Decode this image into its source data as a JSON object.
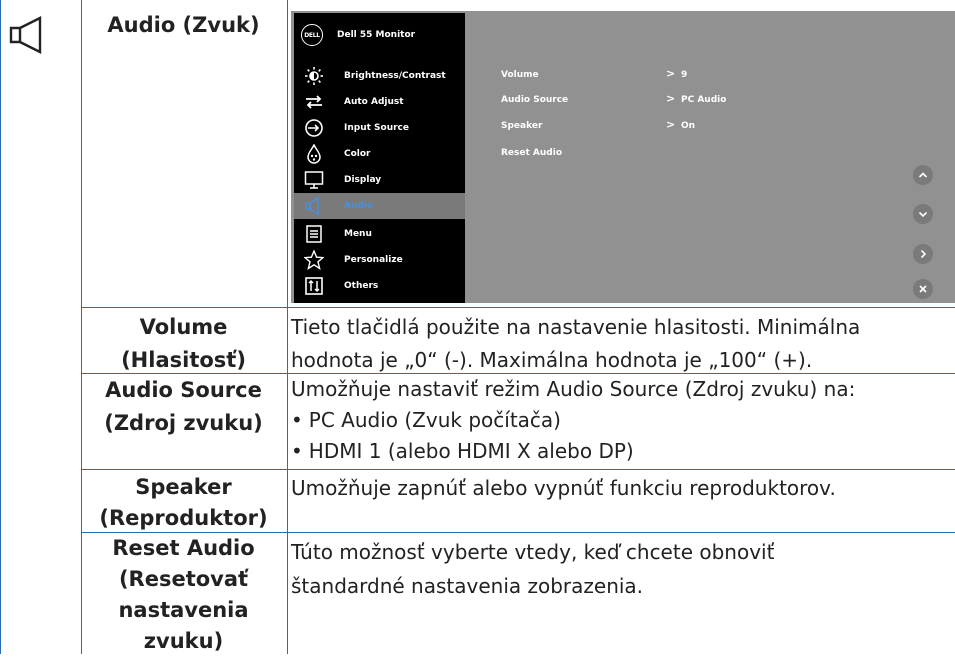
{
  "section_title": "Audio (Zvuk)",
  "osd": {
    "title": "Dell 55 Monitor",
    "logo_text": "DELL",
    "menu": [
      {
        "label": "Brightness/Contrast",
        "icon": "brightness-icon"
      },
      {
        "label": "Auto Adjust",
        "icon": "auto-adjust-icon"
      },
      {
        "label": "Input Source",
        "icon": "input-source-icon"
      },
      {
        "label": "Color",
        "icon": "color-icon"
      },
      {
        "label": "Display",
        "icon": "display-icon"
      },
      {
        "label": "Audio",
        "icon": "speaker-icon",
        "active": true
      },
      {
        "label": "Menu",
        "icon": "menu-icon"
      },
      {
        "label": "Personalize",
        "icon": "star-icon"
      },
      {
        "label": "Others",
        "icon": "others-icon"
      }
    ],
    "submenu": [
      {
        "label": "Volume",
        "value": "9"
      },
      {
        "label": "Audio Source",
        "value": "PC Audio"
      },
      {
        "label": "Speaker",
        "value": "On"
      },
      {
        "label": "Reset Audio",
        "value": ""
      }
    ],
    "nav_buttons": [
      "up-icon",
      "down-icon",
      "right-icon",
      "close-icon"
    ],
    "colors": {
      "panel_bg": "#919191",
      "menu_bg": "#000000",
      "active_bg": "#7a7a7a",
      "active_text": "#4a90d9"
    }
  },
  "rows": [
    {
      "head": [
        "Volume",
        "(Hlasitosť)"
      ],
      "desc": [
        "Tieto tlačidlá použite na nastavenie hlasitosti. Minimálna",
        "hodnota je „0“ (-). Maximálna hodnota je „100“ (+)."
      ]
    },
    {
      "head": [
        "Audio Source",
        "(Zdroj zvuku)"
      ],
      "desc": [
        "Umožňuje nastaviť režim Audio Source (Zdroj zvuku) na:"
      ],
      "bullets": [
        "PC Audio (Zvuk počítača)",
        "HDMI 1 (alebo HDMI X alebo DP)"
      ]
    },
    {
      "head": [
        "Speaker",
        "(Reproduktor)"
      ],
      "desc": [
        "Umožňuje zapnúť alebo vypnúť funkciu reproduktorov."
      ]
    },
    {
      "head": [
        "Reset Audio",
        "(Resetovať",
        "nastavenia",
        "zvuku)"
      ],
      "desc": [
        "Túto možnosť vyberte vtedy, keď chcete obnoviť",
        "štandardné nastavenia zobrazenia."
      ]
    }
  ],
  "colors": {
    "border": "#2a6db0",
    "text": "#222222"
  }
}
